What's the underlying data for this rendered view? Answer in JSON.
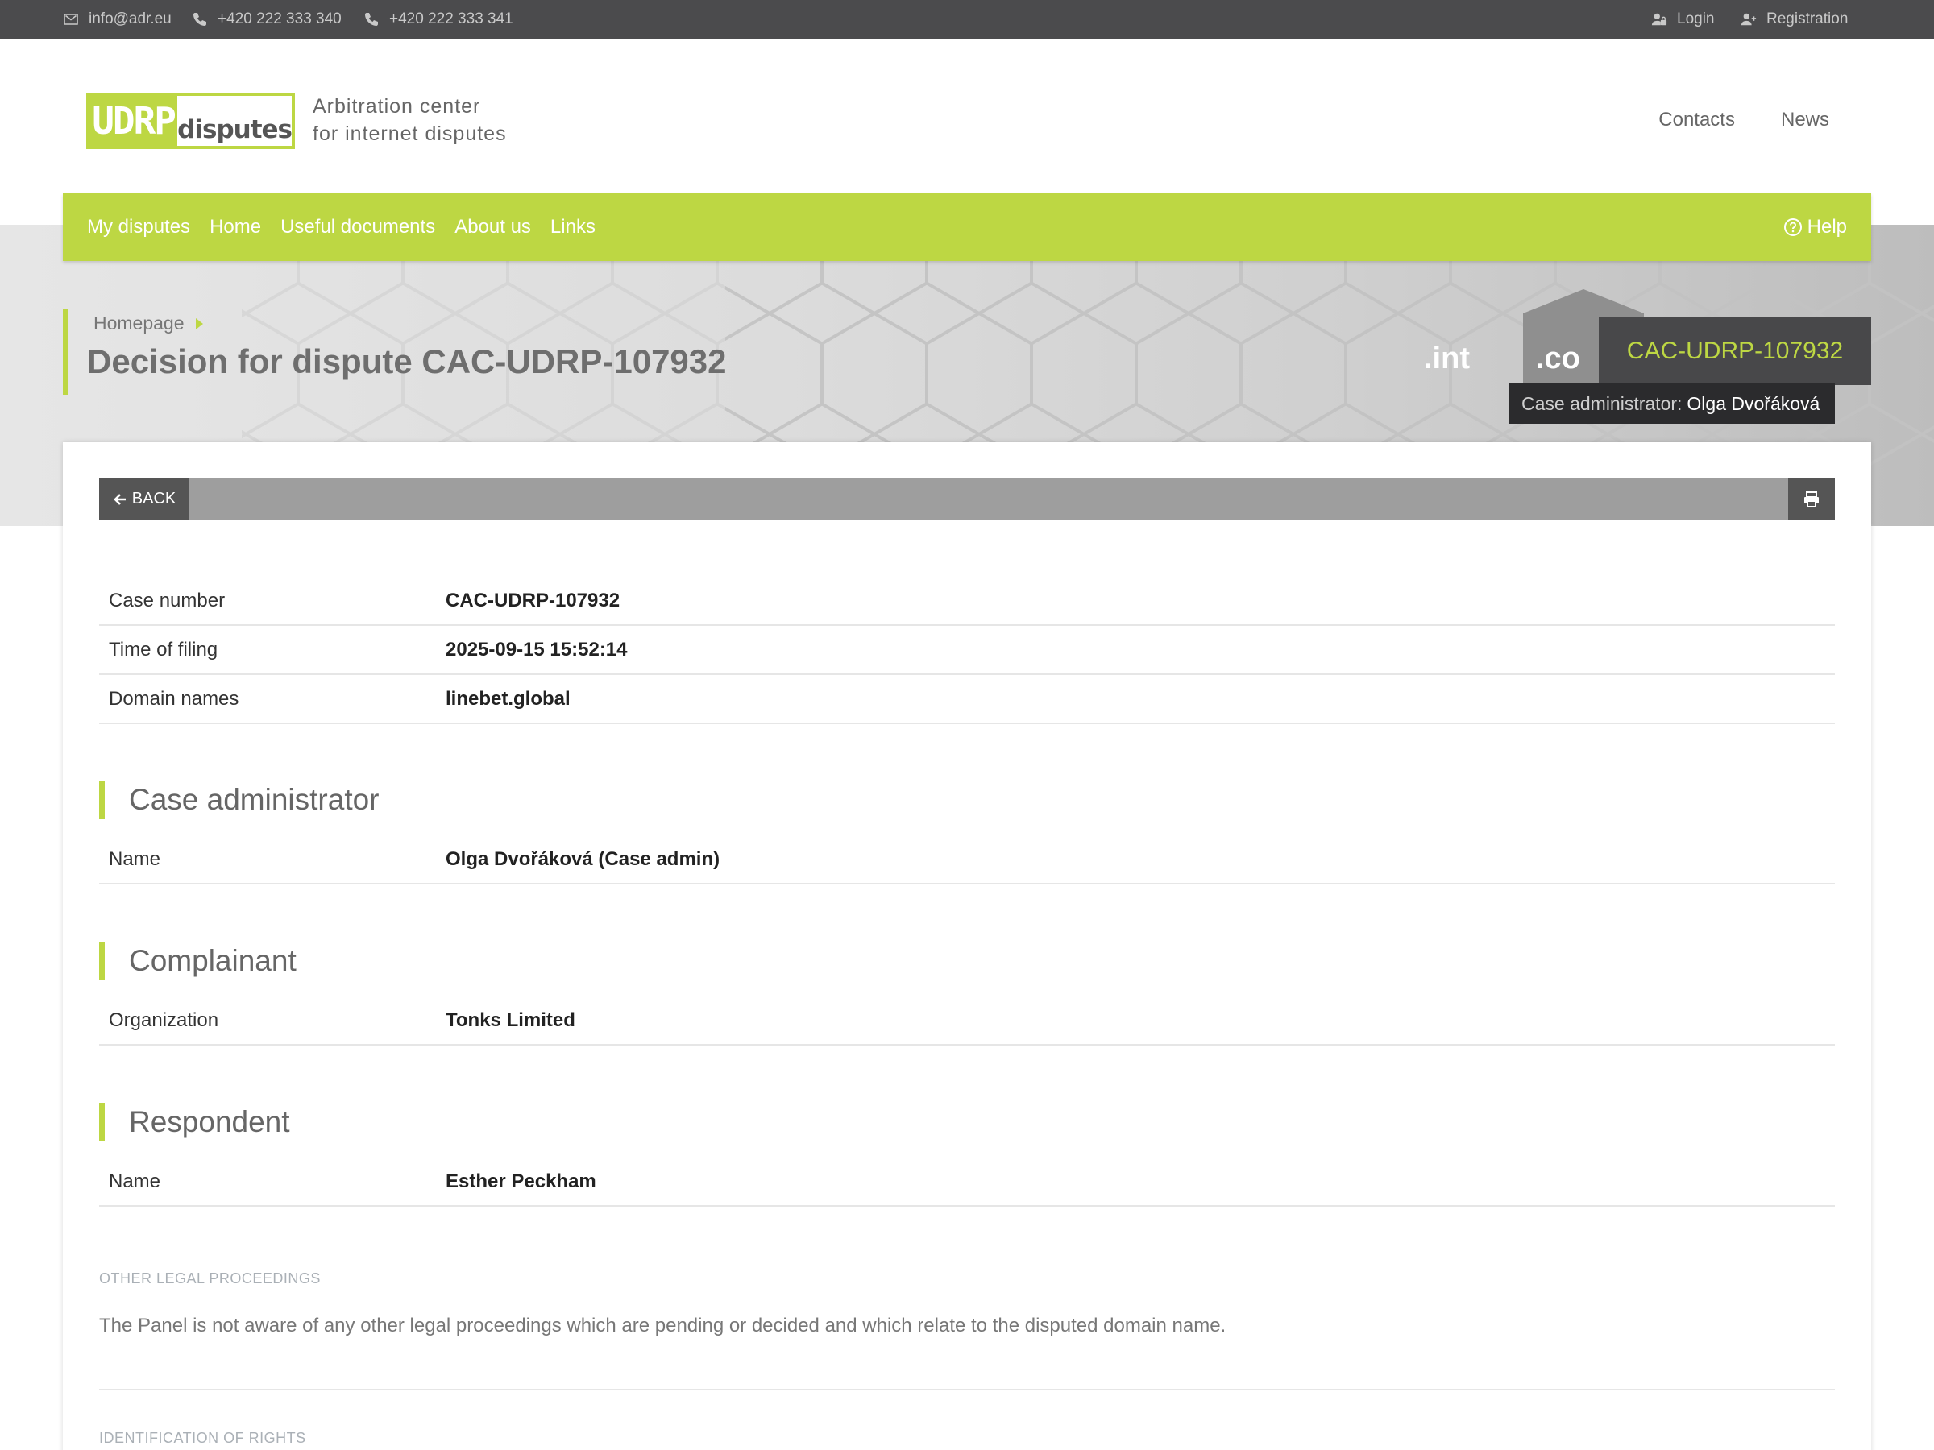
{
  "topbar": {
    "email": "info@adr.eu",
    "phone1": "+420 222 333 340",
    "phone2": "+420 222 333 341",
    "login": "Login",
    "registration": "Registration"
  },
  "header": {
    "logo_part1": "UDRP",
    "logo_part2": "disputes",
    "tagline_line1": "Arbitration center",
    "tagline_line2": "for internet disputes",
    "links": [
      "Contacts",
      "News"
    ]
  },
  "nav": {
    "items": [
      "My disputes",
      "Home",
      "Useful documents",
      "About us",
      "Links"
    ],
    "help": "Help"
  },
  "hero": {
    "bg_labels": [
      ".int",
      ".co"
    ]
  },
  "breadcrumb": {
    "home": "Homepage"
  },
  "page": {
    "title": "Decision for dispute CAC-UDRP-107932",
    "badge": "CAC-UDRP-107932",
    "admin_label": "Case administrator:",
    "admin_name": "Olga Dvořáková"
  },
  "toolbar": {
    "back_label": "BACK"
  },
  "case_info": [
    {
      "label": "Case number",
      "value": "CAC-UDRP-107932"
    },
    {
      "label": "Time of filing",
      "value": "2025-09-15 15:52:14"
    },
    {
      "label": "Domain names",
      "value": "linebet.global"
    }
  ],
  "case_administrator": {
    "heading": "Case administrator",
    "label": "Name",
    "value": "Olga Dvořáková (Case admin)"
  },
  "complainant": {
    "heading": "Complainant",
    "label": "Organization",
    "value": "Tonks Limited"
  },
  "respondent": {
    "heading": "Respondent",
    "label": "Name",
    "value": "Esther Peckham"
  },
  "other_legal": {
    "heading": "OTHER LEGAL PROCEEDINGS",
    "text": "The Panel is not aware of any other legal proceedings which are pending or decided and which relate to the disputed domain name."
  },
  "identification": {
    "heading": "IDENTIFICATION OF RIGHTS"
  },
  "colors": {
    "accent": "#bdd743",
    "topbar": "#4b4b4d",
    "badge_bg": "#48484a",
    "admin_bg": "#2b2b2d"
  }
}
